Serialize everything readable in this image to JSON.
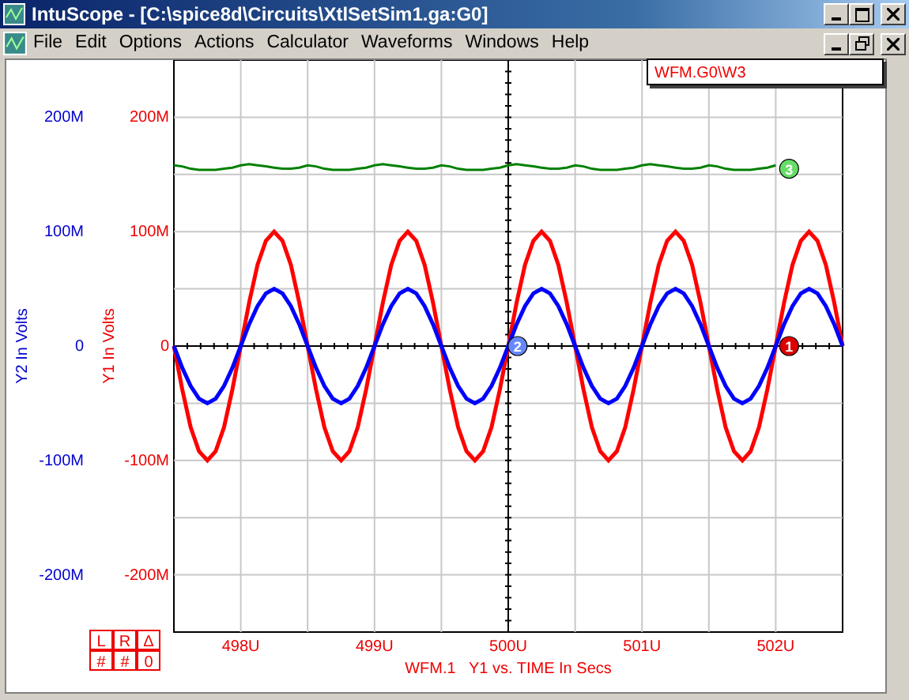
{
  "window": {
    "title": "IntuScope - [C:\\spice8d\\Circuits\\XtlSetSim1.ga:G0]"
  },
  "menu": [
    "File",
    "Edit",
    "Options",
    "Actions",
    "Calculator",
    "Waveforms",
    "Windows",
    "Help"
  ],
  "legend": {
    "text": "WFM.G0\\W3"
  },
  "y2_axis": {
    "label": "Y2 In Volts",
    "ticks": [
      "200M",
      "100M",
      "0",
      "-100M",
      "-200M"
    ]
  },
  "cursor_buttons": [
    [
      "L",
      "R",
      "Δ"
    ],
    [
      "#",
      "#",
      "0"
    ]
  ],
  "markers": [
    {
      "label": "3",
      "color": "#66dd66"
    },
    {
      "label": "1",
      "color": "#dd0000"
    },
    {
      "label": "2",
      "color": "#6688ff"
    }
  ],
  "chart_data": {
    "type": "line",
    "title": "WFM.1   Y1 vs. TIME In Secs",
    "ylabel": "Y1 In Volts",
    "grid": true,
    "xlim": [
      497.5,
      502.5
    ],
    "ylim": [
      -250,
      250
    ],
    "xticks": [
      {
        "value": 498,
        "label": "498U"
      },
      {
        "value": 499,
        "label": "499U"
      },
      {
        "value": 500,
        "label": "500U"
      },
      {
        "value": 501,
        "label": "501U"
      },
      {
        "value": 502,
        "label": "502U"
      }
    ],
    "yticks": [
      {
        "value": 200,
        "label": "200M"
      },
      {
        "value": 100,
        "label": "100M"
      },
      {
        "value": 0,
        "label": "0"
      },
      {
        "value": -100,
        "label": "-100M"
      },
      {
        "value": -200,
        "label": "-200M"
      }
    ],
    "x": [
      497.5,
      497.5625,
      497.625,
      497.6875,
      497.75,
      497.8125,
      497.875,
      497.9375,
      498,
      498.0625,
      498.125,
      498.1875,
      498.25,
      498.3125,
      498.375,
      498.4375,
      498.5,
      498.5625,
      498.625,
      498.6875,
      498.75,
      498.8125,
      498.875,
      498.9375,
      499,
      499.0625,
      499.125,
      499.1875,
      499.25,
      499.3125,
      499.375,
      499.4375,
      499.5,
      499.5625,
      499.625,
      499.6875,
      499.75,
      499.8125,
      499.875,
      499.9375,
      500,
      500.0625,
      500.125,
      500.1875,
      500.25,
      500.3125,
      500.375,
      500.4375,
      500.5,
      500.5625,
      500.625,
      500.6875,
      500.75,
      500.8125,
      500.875,
      500.9375,
      501,
      501.0625,
      501.125,
      501.1875,
      501.25,
      501.3125,
      501.375,
      501.4375,
      501.5,
      501.5625,
      501.625,
      501.6875,
      501.75,
      501.8125,
      501.875,
      501.9375,
      502,
      502.0625,
      502.125,
      502.1875,
      502.25,
      502.3125,
      502.375,
      502.4375,
      502.5
    ],
    "series": [
      {
        "color": "#008000",
        "values": [
          158,
          157,
          155,
          154,
          154,
          154,
          155,
          156,
          158,
          159,
          158,
          157,
          156,
          155,
          155,
          156,
          158,
          157,
          155,
          154,
          154,
          154,
          155,
          156,
          158,
          159,
          158,
          157,
          156,
          155,
          155,
          156,
          158,
          157,
          155,
          154,
          154,
          154,
          155,
          156,
          158,
          159,
          158,
          157,
          156,
          155,
          155,
          156,
          158,
          157,
          155,
          154,
          154,
          154,
          155,
          156,
          158,
          159,
          158,
          157,
          156,
          155,
          155,
          156,
          158,
          157,
          155,
          154,
          154,
          154,
          155,
          156,
          158,
          null,
          null,
          null,
          null,
          null,
          null,
          null,
          null
        ]
      },
      {
        "color": "#ff0000",
        "values": [
          0,
          -38,
          -71,
          -92,
          -100,
          -92,
          -71,
          -38,
          0,
          38,
          71,
          92,
          100,
          92,
          71,
          38,
          0,
          -38,
          -71,
          -92,
          -100,
          -92,
          -71,
          -38,
          0,
          38,
          71,
          92,
          100,
          92,
          71,
          38,
          0,
          -38,
          -71,
          -92,
          -100,
          -92,
          -71,
          -38,
          0,
          38,
          71,
          92,
          100,
          92,
          71,
          38,
          0,
          -38,
          -71,
          -92,
          -100,
          -92,
          -71,
          -38,
          0,
          38,
          71,
          92,
          100,
          92,
          71,
          38,
          0,
          -38,
          -71,
          -92,
          -100,
          -92,
          -71,
          -38,
          0,
          38,
          71,
          92,
          100,
          92,
          71,
          38,
          0
        ]
      },
      {
        "color": "#0000ff",
        "values": [
          0,
          -19,
          -35,
          -46,
          -50,
          -46,
          -35,
          -19,
          0,
          19,
          35,
          46,
          50,
          46,
          35,
          19,
          0,
          -19,
          -35,
          -46,
          -50,
          -46,
          -35,
          -19,
          0,
          19,
          35,
          46,
          50,
          46,
          35,
          19,
          0,
          -19,
          -35,
          -46,
          -50,
          -46,
          -35,
          -19,
          0,
          19,
          35,
          46,
          50,
          46,
          35,
          19,
          0,
          -19,
          -35,
          -46,
          -50,
          -46,
          -35,
          -19,
          0,
          19,
          35,
          46,
          50,
          46,
          35,
          19,
          0,
          -19,
          -35,
          -46,
          -50,
          -46,
          -35,
          -19,
          0,
          19,
          35,
          46,
          50,
          46,
          35,
          19,
          0
        ]
      }
    ]
  }
}
